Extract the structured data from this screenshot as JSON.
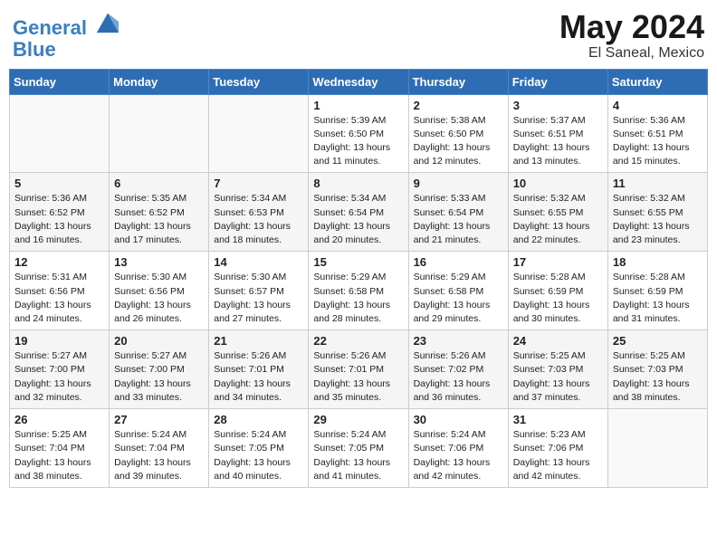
{
  "header": {
    "logo_line1": "General",
    "logo_line2": "Blue",
    "title": "May 2024",
    "subtitle": "El Saneal, Mexico"
  },
  "days_of_week": [
    "Sunday",
    "Monday",
    "Tuesday",
    "Wednesday",
    "Thursday",
    "Friday",
    "Saturday"
  ],
  "weeks": [
    [
      {
        "day": "",
        "info": ""
      },
      {
        "day": "",
        "info": ""
      },
      {
        "day": "",
        "info": ""
      },
      {
        "day": "1",
        "info": "Sunrise: 5:39 AM\nSunset: 6:50 PM\nDaylight: 13 hours\nand 11 minutes."
      },
      {
        "day": "2",
        "info": "Sunrise: 5:38 AM\nSunset: 6:50 PM\nDaylight: 13 hours\nand 12 minutes."
      },
      {
        "day": "3",
        "info": "Sunrise: 5:37 AM\nSunset: 6:51 PM\nDaylight: 13 hours\nand 13 minutes."
      },
      {
        "day": "4",
        "info": "Sunrise: 5:36 AM\nSunset: 6:51 PM\nDaylight: 13 hours\nand 15 minutes."
      }
    ],
    [
      {
        "day": "5",
        "info": "Sunrise: 5:36 AM\nSunset: 6:52 PM\nDaylight: 13 hours\nand 16 minutes."
      },
      {
        "day": "6",
        "info": "Sunrise: 5:35 AM\nSunset: 6:52 PM\nDaylight: 13 hours\nand 17 minutes."
      },
      {
        "day": "7",
        "info": "Sunrise: 5:34 AM\nSunset: 6:53 PM\nDaylight: 13 hours\nand 18 minutes."
      },
      {
        "day": "8",
        "info": "Sunrise: 5:34 AM\nSunset: 6:54 PM\nDaylight: 13 hours\nand 20 minutes."
      },
      {
        "day": "9",
        "info": "Sunrise: 5:33 AM\nSunset: 6:54 PM\nDaylight: 13 hours\nand 21 minutes."
      },
      {
        "day": "10",
        "info": "Sunrise: 5:32 AM\nSunset: 6:55 PM\nDaylight: 13 hours\nand 22 minutes."
      },
      {
        "day": "11",
        "info": "Sunrise: 5:32 AM\nSunset: 6:55 PM\nDaylight: 13 hours\nand 23 minutes."
      }
    ],
    [
      {
        "day": "12",
        "info": "Sunrise: 5:31 AM\nSunset: 6:56 PM\nDaylight: 13 hours\nand 24 minutes."
      },
      {
        "day": "13",
        "info": "Sunrise: 5:30 AM\nSunset: 6:56 PM\nDaylight: 13 hours\nand 26 minutes."
      },
      {
        "day": "14",
        "info": "Sunrise: 5:30 AM\nSunset: 6:57 PM\nDaylight: 13 hours\nand 27 minutes."
      },
      {
        "day": "15",
        "info": "Sunrise: 5:29 AM\nSunset: 6:58 PM\nDaylight: 13 hours\nand 28 minutes."
      },
      {
        "day": "16",
        "info": "Sunrise: 5:29 AM\nSunset: 6:58 PM\nDaylight: 13 hours\nand 29 minutes."
      },
      {
        "day": "17",
        "info": "Sunrise: 5:28 AM\nSunset: 6:59 PM\nDaylight: 13 hours\nand 30 minutes."
      },
      {
        "day": "18",
        "info": "Sunrise: 5:28 AM\nSunset: 6:59 PM\nDaylight: 13 hours\nand 31 minutes."
      }
    ],
    [
      {
        "day": "19",
        "info": "Sunrise: 5:27 AM\nSunset: 7:00 PM\nDaylight: 13 hours\nand 32 minutes."
      },
      {
        "day": "20",
        "info": "Sunrise: 5:27 AM\nSunset: 7:00 PM\nDaylight: 13 hours\nand 33 minutes."
      },
      {
        "day": "21",
        "info": "Sunrise: 5:26 AM\nSunset: 7:01 PM\nDaylight: 13 hours\nand 34 minutes."
      },
      {
        "day": "22",
        "info": "Sunrise: 5:26 AM\nSunset: 7:01 PM\nDaylight: 13 hours\nand 35 minutes."
      },
      {
        "day": "23",
        "info": "Sunrise: 5:26 AM\nSunset: 7:02 PM\nDaylight: 13 hours\nand 36 minutes."
      },
      {
        "day": "24",
        "info": "Sunrise: 5:25 AM\nSunset: 7:03 PM\nDaylight: 13 hours\nand 37 minutes."
      },
      {
        "day": "25",
        "info": "Sunrise: 5:25 AM\nSunset: 7:03 PM\nDaylight: 13 hours\nand 38 minutes."
      }
    ],
    [
      {
        "day": "26",
        "info": "Sunrise: 5:25 AM\nSunset: 7:04 PM\nDaylight: 13 hours\nand 38 minutes."
      },
      {
        "day": "27",
        "info": "Sunrise: 5:24 AM\nSunset: 7:04 PM\nDaylight: 13 hours\nand 39 minutes."
      },
      {
        "day": "28",
        "info": "Sunrise: 5:24 AM\nSunset: 7:05 PM\nDaylight: 13 hours\nand 40 minutes."
      },
      {
        "day": "29",
        "info": "Sunrise: 5:24 AM\nSunset: 7:05 PM\nDaylight: 13 hours\nand 41 minutes."
      },
      {
        "day": "30",
        "info": "Sunrise: 5:24 AM\nSunset: 7:06 PM\nDaylight: 13 hours\nand 42 minutes."
      },
      {
        "day": "31",
        "info": "Sunrise: 5:23 AM\nSunset: 7:06 PM\nDaylight: 13 hours\nand 42 minutes."
      },
      {
        "day": "",
        "info": ""
      }
    ]
  ]
}
